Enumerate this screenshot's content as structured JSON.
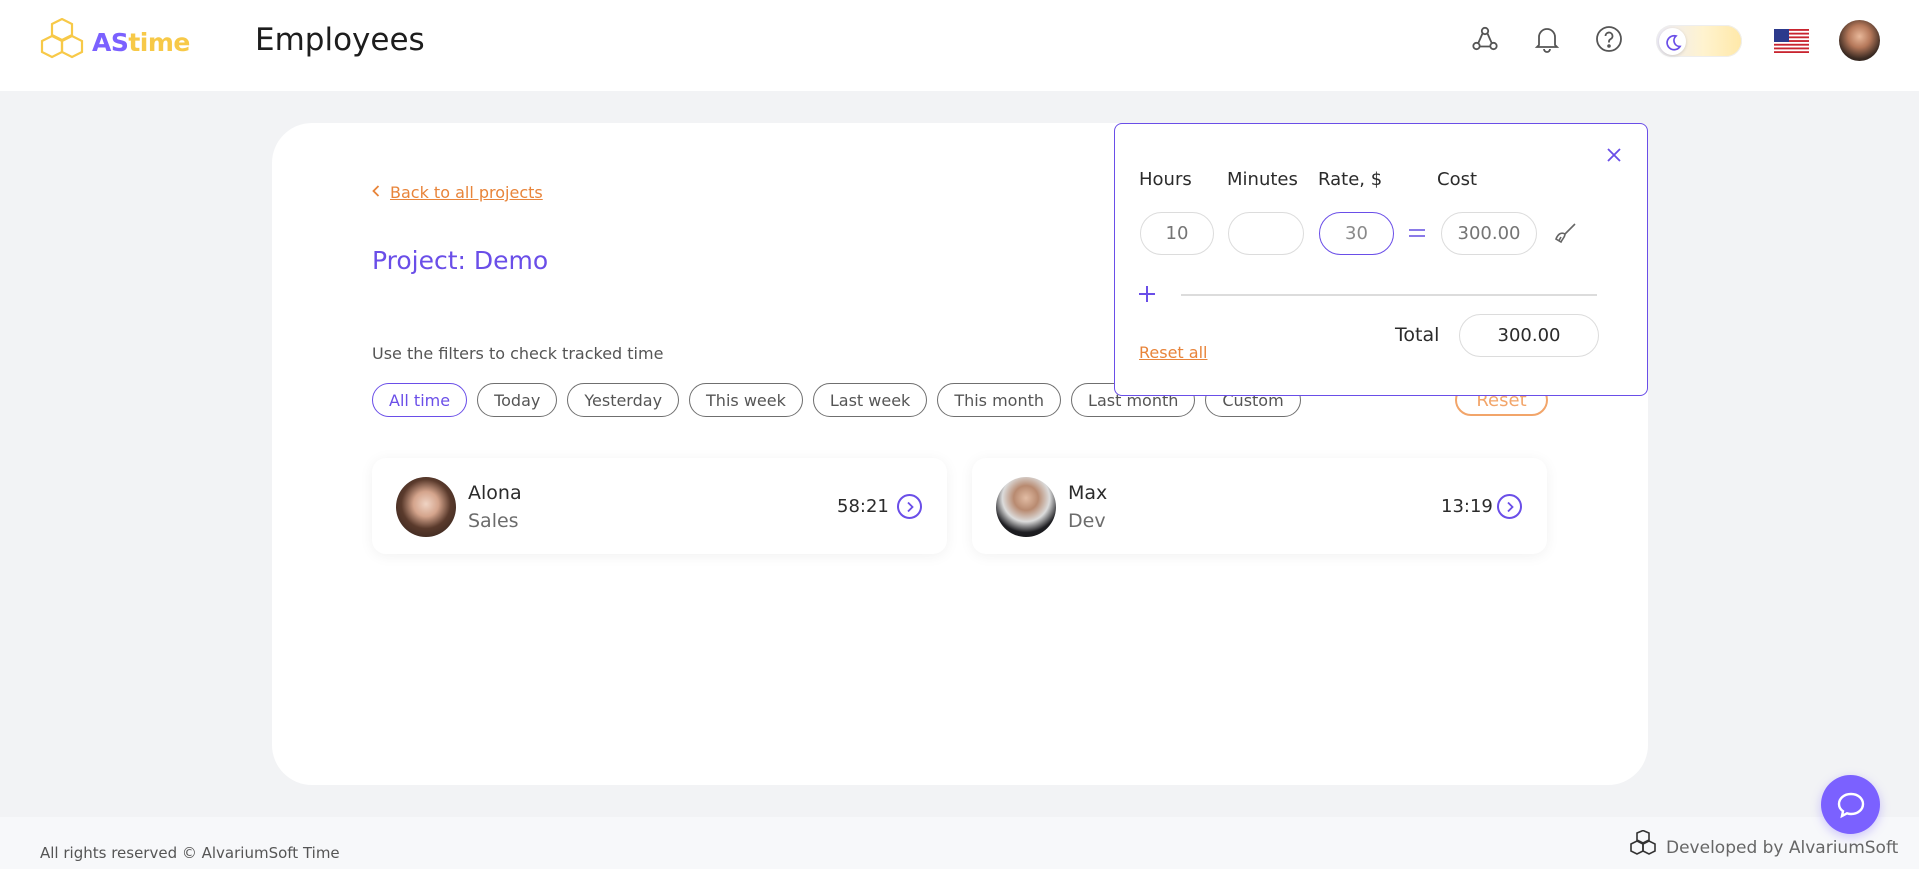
{
  "app": {
    "logo_as": "AS",
    "logo_time": "time"
  },
  "header": {
    "title": "Employees",
    "icons": [
      "network-icon",
      "bell-icon",
      "help-icon",
      "moon-icon",
      "us-flag-icon",
      "user-avatar"
    ]
  },
  "main": {
    "back_link": "Back to all projects",
    "project_title": "Project: Demo",
    "filter_hint": "Use the filters to check tracked time",
    "filters": [
      "All time",
      "Today",
      "Yesterday",
      "This week",
      "Last week",
      "This month",
      "Last month",
      "Custom"
    ],
    "active_filter": "All time",
    "reset_label": "Reset",
    "employees": [
      {
        "name": "Alona",
        "dept": "Sales",
        "time": "58:21"
      },
      {
        "name": "Max",
        "dept": "Dev",
        "time": "13:19"
      }
    ]
  },
  "calculator": {
    "hours_label": "Hours",
    "minutes_label": "Minutes",
    "rate_label": "Rate, $",
    "cost_label": "Cost",
    "hours_placeholder": "10",
    "minutes_value": "",
    "rate_value": "30",
    "cost_placeholder": "300.00",
    "reset_all": "Reset all",
    "total_label": "Total",
    "total_value": "300.00"
  },
  "footer": {
    "copyright": "All rights reserved © AlvariumSoft Time",
    "developed_by": "Developed by AlvariumSoft"
  },
  "colors": {
    "accent": "#6a4ee8",
    "orange": "#e8843a",
    "logo_yellow": "#f7c948"
  }
}
